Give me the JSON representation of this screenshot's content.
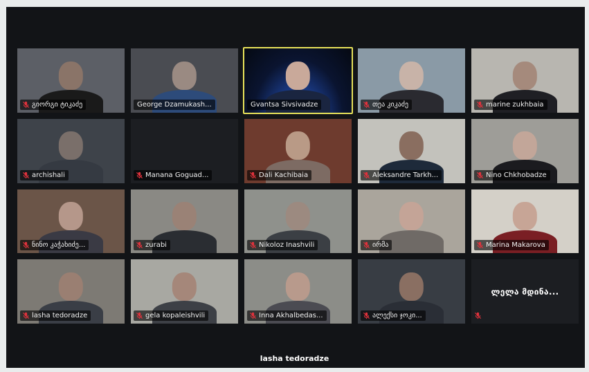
{
  "meeting": {
    "bottom_label": "lasha tedoradze",
    "participants": [
      {
        "name": "გიორგი ტიკაძე",
        "muted": true,
        "bg": "#5c5f66",
        "skin": "#8a7468",
        "shirt": "#1a1a1a"
      },
      {
        "name": "George Dzamukash...",
        "muted": false,
        "bg": "#4a4c52",
        "skin": "#9a8a82",
        "shirt": "#2d4b7a"
      },
      {
        "name": "Gvantsa Sivsivadze",
        "muted": false,
        "bg": "#0f1a3a",
        "skin": "#c9a99a",
        "shirt": "#1a2540",
        "speaking": true
      },
      {
        "name": "თეა კიკაძე",
        "muted": true,
        "bg": "#8a9aa6",
        "skin": "#c8b3a8",
        "shirt": "#2a2a30"
      },
      {
        "name": "marine zukhbaia",
        "muted": true,
        "bg": "#b8b6b0",
        "skin": "#a58a7c",
        "shirt": "#1f1f24"
      },
      {
        "name": "archishali",
        "muted": true,
        "bg": "#3e434a",
        "skin": "#7a6f6a",
        "shirt": "#353a42"
      },
      {
        "name": "Manana Goguad...",
        "muted": true,
        "bg": "#1c1e22",
        "skin": "#1c1e22",
        "shirt": "#1c1e22",
        "dark": true
      },
      {
        "name": "Dali Kachibaia",
        "muted": true,
        "bg": "#6e3b2e",
        "skin": "#b99a86",
        "shirt": "#7d6b63"
      },
      {
        "name": "Aleksandre Tarkh...",
        "muted": true,
        "bg": "#c3c2bc",
        "skin": "#8a6e60",
        "shirt": "#1e2a3a"
      },
      {
        "name": "Nino Chkhobadze",
        "muted": true,
        "bg": "#9e9d98",
        "skin": "#c2a699",
        "shirt": "#1b1b1f"
      },
      {
        "name": "ნინო კაჭახიძე...",
        "muted": true,
        "bg": "#6b5548",
        "skin": "#b5978a",
        "shirt": "#3a3a44"
      },
      {
        "name": "zurabi",
        "muted": true,
        "bg": "#8a8984",
        "skin": "#9a8276",
        "shirt": "#2a2d32"
      },
      {
        "name": "Nikoloz Inashvili",
        "muted": true,
        "bg": "#8f918c",
        "skin": "#9c8a80",
        "shirt": "#3b3f44"
      },
      {
        "name": "ირმა",
        "muted": true,
        "bg": "#aaa59c",
        "skin": "#c4a497",
        "shirt": "#6f6a66"
      },
      {
        "name": "Marina Makarova",
        "muted": true,
        "bg": "#d4d0c8",
        "skin": "#c7a596",
        "shirt": "#7a1f24"
      },
      {
        "name": "lasha tedoradze",
        "muted": true,
        "bg": "#7d7a74",
        "skin": "#9a7f72",
        "shirt": "#3a3e46"
      },
      {
        "name": "gela kopaleishvili",
        "muted": true,
        "bg": "#a8a8a2",
        "skin": "#a5877a",
        "shirt": "#3d4046"
      },
      {
        "name": "Inna Akhalbedas...",
        "muted": true,
        "bg": "#8c8d88",
        "skin": "#b89a8c",
        "shirt": "#4b4b52"
      },
      {
        "name": "ალექსი ჯოკი...",
        "muted": true,
        "bg": "#383d44",
        "skin": "#8a6f62",
        "shirt": "#2a2e36"
      },
      {
        "name": "ლელა მდინა...",
        "muted": true,
        "bg": "#1c1e22",
        "text_only": true
      }
    ]
  },
  "colors": {
    "speaker_border": "#e9e35a",
    "muted_icon": "#e0323c",
    "tile_label_bg": "rgba(0,0,0,0.62)"
  }
}
